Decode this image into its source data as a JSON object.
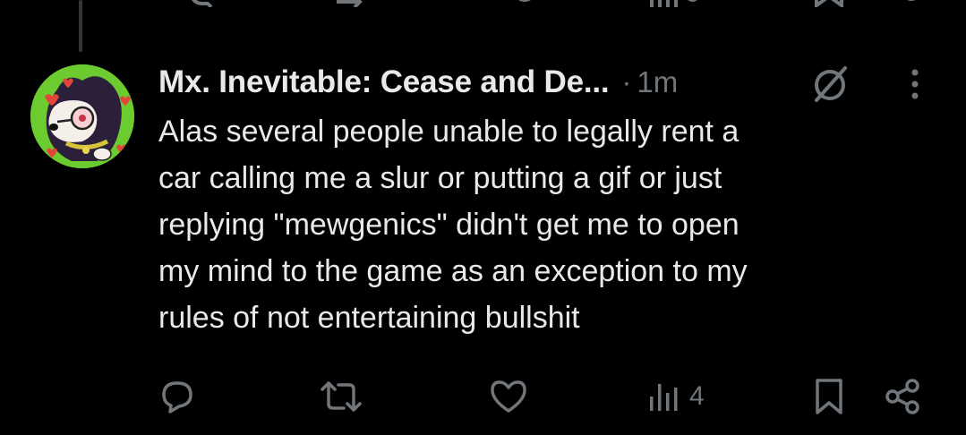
{
  "tweet": {
    "display_name": "Mx. Inevitable: Cease and De...",
    "separator": "·",
    "timestamp": "1m",
    "text": "Alas several people unable to legally rent a\ncar calling me a slur or putting a gif or just\nreplying \"mewgenics\" didn't get me to open\nmy mind to the game as an exception to my\nrules of not entertaining bullshit",
    "views": "4"
  },
  "icons": {
    "avatar": "avatar",
    "hidden_reply": "hidden-reply-icon",
    "more": "more-icon",
    "reply": "reply-icon",
    "retweet": "retweet-icon",
    "like": "like-icon",
    "views": "views-icon",
    "bookmark": "bookmark-icon",
    "share": "share-icon"
  },
  "colors": {
    "background": "#000000",
    "text": "#e7e9ea",
    "muted": "#71767b",
    "thread_line": "#333639",
    "avatar_bg": "#6ccb2f"
  }
}
